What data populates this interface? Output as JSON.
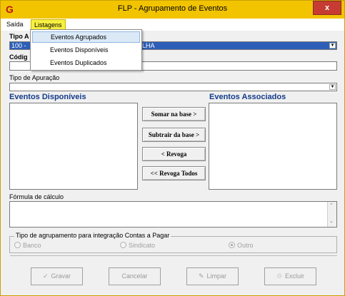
{
  "window": {
    "title": "FLP - Agrupamento de Eventos",
    "close_glyph": "x",
    "app_icon": "G"
  },
  "menubar": {
    "items": [
      "Saída",
      "Listagens"
    ]
  },
  "dropdown": {
    "items": [
      "Eventos Agrupados",
      "Eventos Disponíveis",
      "Eventos Duplicados"
    ],
    "highlighted": 0
  },
  "form": {
    "tipo_label": "Tipo A",
    "tipo_value": "100 - ",
    "tipo_suffix": "LHA",
    "codigo_label": "Códig",
    "apuracao_label": "Tipo de Apuração",
    "disponiveis_title": "Eventos Disponíveis",
    "associados_title": "Eventos Associados",
    "formula_label": "Fórmula de cálculo",
    "group_title": "Tipo de agrupamento para integração Contas a Pagar",
    "radio_banco": "Banco",
    "radio_sindicato": "Sindicato",
    "radio_outro": "Outro"
  },
  "transfer_buttons": {
    "somar": "Somar  na base >",
    "subtrair": "Subtrair da base >",
    "revoga": "< Revoga",
    "revoga_todos": "<< Revoga Todos"
  },
  "actions": {
    "gravar": "Gravar",
    "cancelar": "Cancelar",
    "limpar": "Limpar",
    "excluir": "Excluir"
  },
  "icons": {
    "gravar": "check-icon",
    "limpar": "broom-icon",
    "excluir": "trash-icon"
  },
  "colors": {
    "titlebar": "#f2c400",
    "selection": "#2d5fb8",
    "section_title": "#123a8a"
  }
}
